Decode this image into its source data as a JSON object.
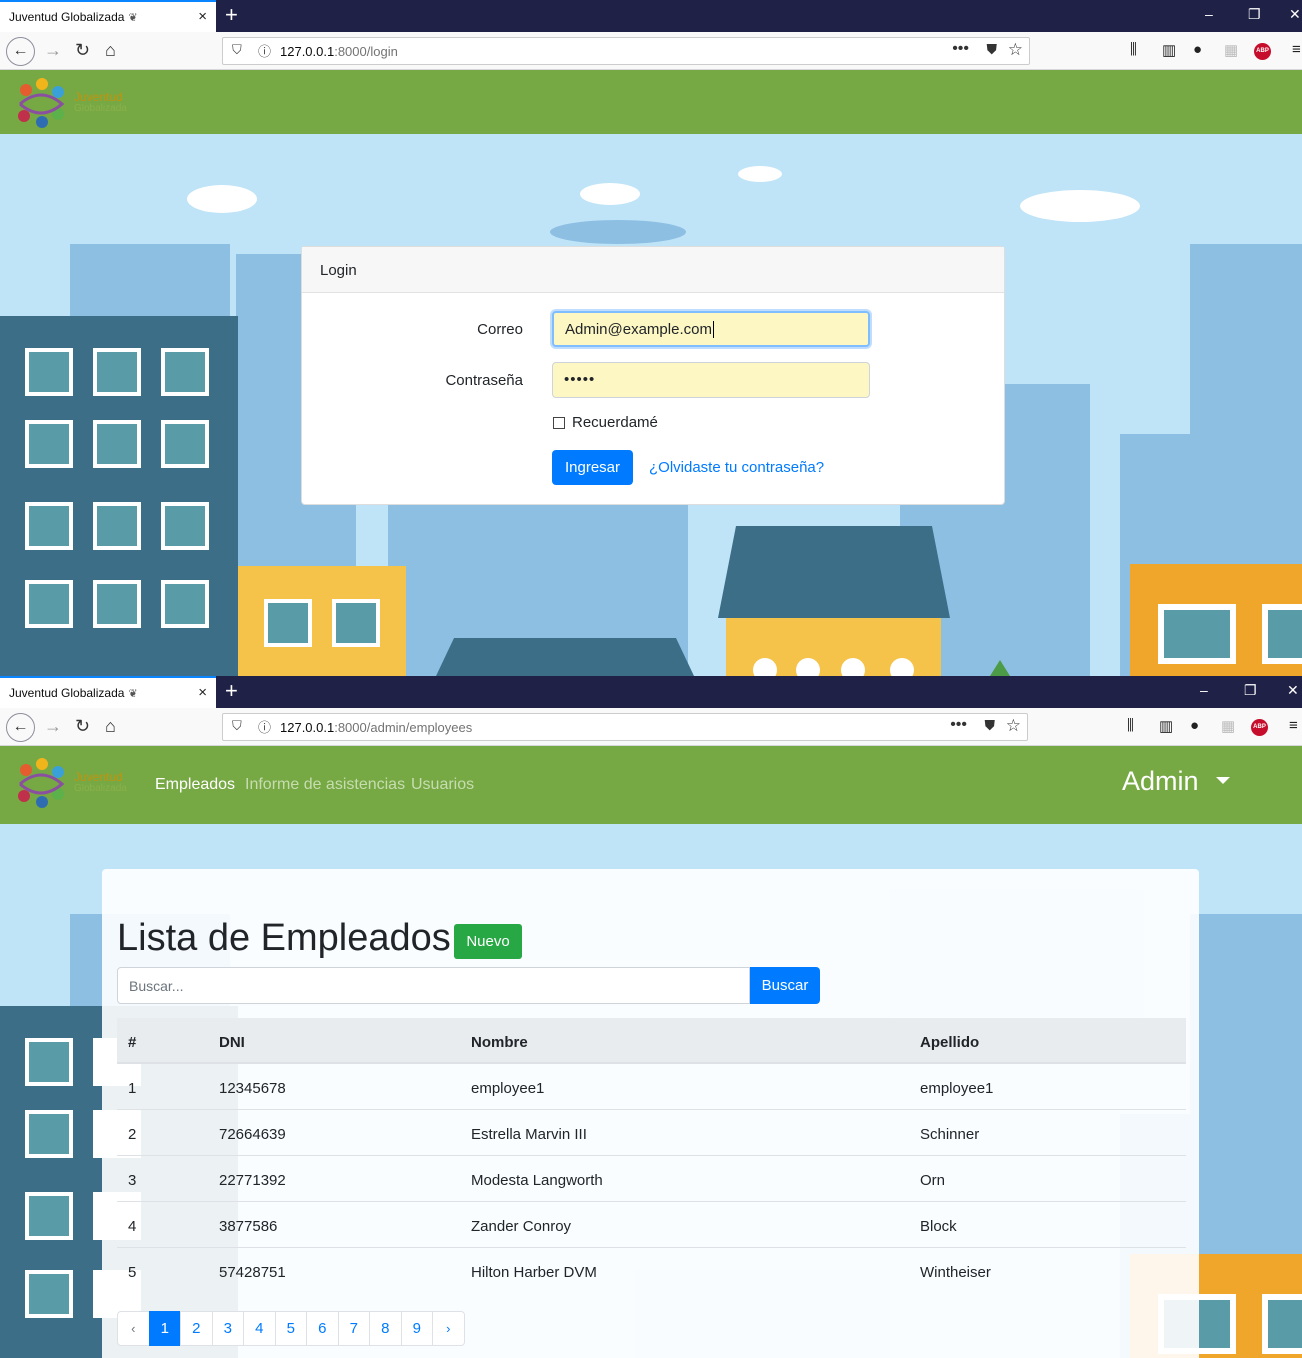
{
  "shot1": {
    "tab": {
      "title": "Juventud Globalizada",
      "close": "×"
    },
    "new_tab": "+",
    "window": {
      "minimize": "–",
      "restore": "❐",
      "close": "✕"
    },
    "url": {
      "host": "127.0.0.1",
      "rest": ":8000/login"
    },
    "site": {
      "brand_line1": "Juventud",
      "brand_line2": "Globalizada"
    },
    "login": {
      "header": "Login",
      "email_label": "Correo",
      "email_value": "Admin@example.com",
      "password_label": "Contraseña",
      "password_value": "•••••",
      "remember_label": "Recuerdamé",
      "submit_label": "Ingresar",
      "forgot_label": "¿Olvidaste tu contraseña?"
    }
  },
  "shot2": {
    "tab": {
      "title": "Juventud Globalizada",
      "close": "×"
    },
    "new_tab": "+",
    "window": {
      "minimize": "–",
      "restore": "❐",
      "close": "✕"
    },
    "url": {
      "host": "127.0.0.1",
      "rest": ":8000/admin/employees"
    },
    "site": {
      "brand_line1": "Juventud",
      "brand_line2": "Globalizada"
    },
    "nav": {
      "employees": "Empleados",
      "attendance": "Informe de asistencias",
      "users": "Usuarios",
      "account": "Admin"
    },
    "page": {
      "title": "Lista de Empleados",
      "new_button": "Nuevo",
      "search_placeholder": "Buscar...",
      "search_button": "Buscar"
    },
    "table": {
      "headers": [
        "#",
        "DNI",
        "Nombre",
        "Apellido"
      ],
      "rows": [
        [
          "1",
          "12345678",
          "employee1",
          "employee1"
        ],
        [
          "2",
          "72664639",
          "Estrella Marvin III",
          "Schinner"
        ],
        [
          "3",
          "22771392",
          "Modesta Langworth",
          "Orn"
        ],
        [
          "4",
          "3877586",
          "Zander Conroy",
          "Block"
        ],
        [
          "5",
          "57428751",
          "Hilton Harber DVM",
          "Wintheiser"
        ]
      ]
    },
    "pagination": {
      "prev": "‹",
      "next": "›",
      "pages": [
        "1",
        "2",
        "3",
        "4",
        "5",
        "6",
        "7",
        "8",
        "9"
      ],
      "current": "1"
    }
  },
  "colors": {
    "header_green": "#76a844",
    "primary": "#007bff",
    "success": "#28a745",
    "browser_dark": "#1f2146"
  }
}
